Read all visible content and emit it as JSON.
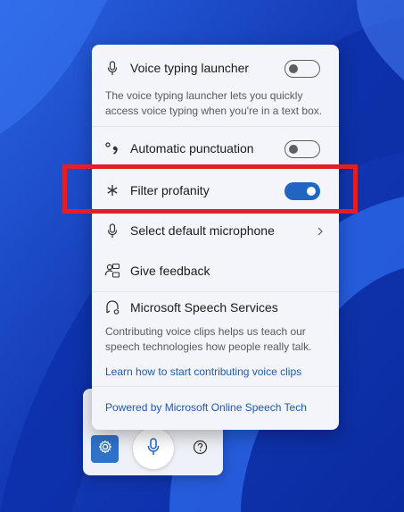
{
  "menu": {
    "voice_launcher": {
      "label": "Voice typing launcher",
      "description": "The voice typing launcher lets you quickly access voice typing when you're in a text box.",
      "enabled": false
    },
    "auto_punct": {
      "label": "Automatic punctuation",
      "enabled": false
    },
    "filter_profanity": {
      "label": "Filter profanity",
      "enabled": true
    },
    "select_mic": {
      "label": "Select default microphone"
    },
    "feedback": {
      "label": "Give feedback"
    },
    "speech_services": {
      "label": "Microsoft Speech Services",
      "description": "Contributing voice clips helps us teach our speech technologies how people really talk.",
      "link": "Learn how to start contributing voice clips"
    },
    "powered_by": "Powered by Microsoft Online Speech Tech"
  },
  "toolbar": {
    "settings_icon": "gear-icon",
    "mic_icon": "microphone-icon",
    "help_icon": "help-icon"
  },
  "colors": {
    "accent": "#1f65c1",
    "highlight": "#e41e26",
    "link": "#1d5ab3"
  }
}
